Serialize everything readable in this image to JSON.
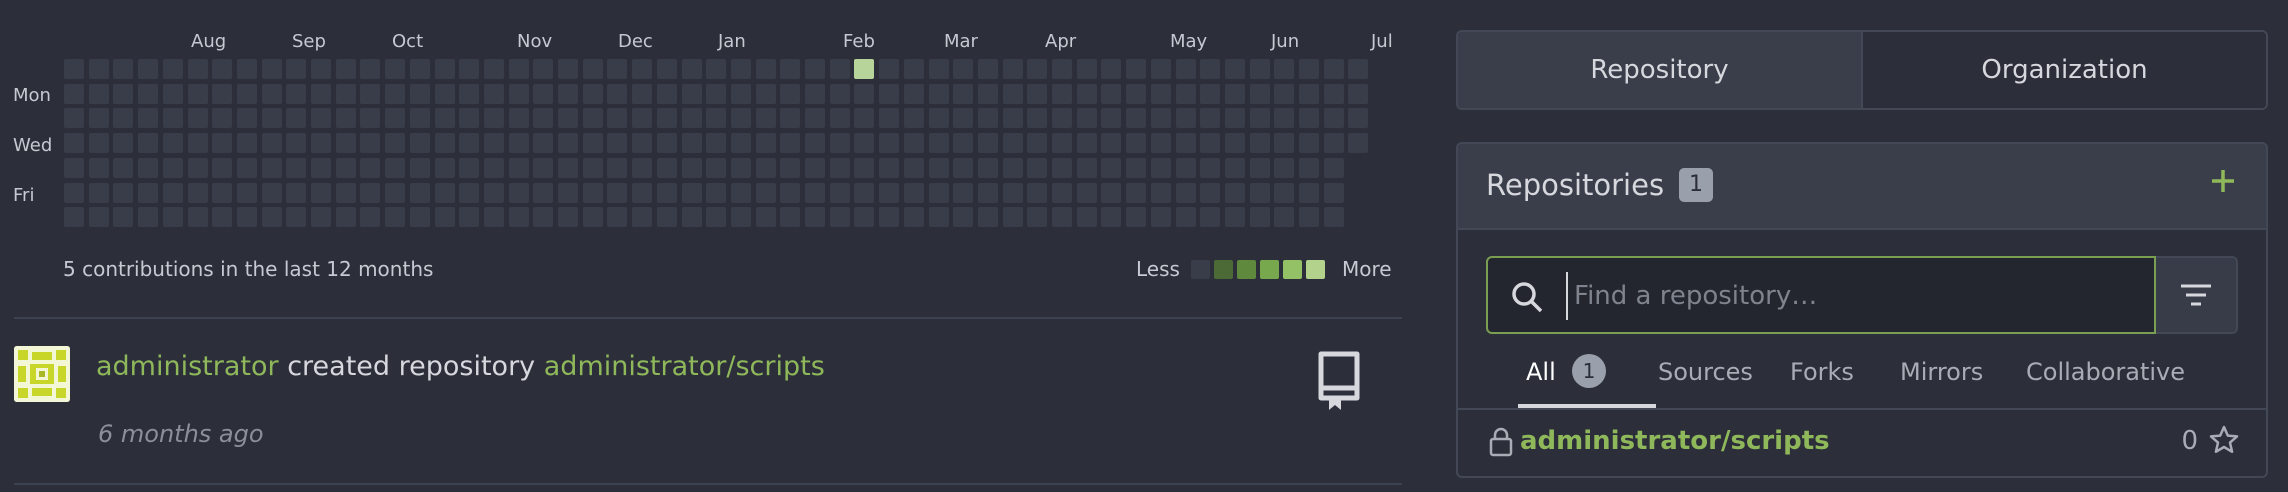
{
  "heatmap": {
    "months": [
      "Aug",
      "Sep",
      "Oct",
      "Nov",
      "Dec",
      "Jan",
      "Feb",
      "Mar",
      "Apr",
      "May",
      "Jun",
      "Jul"
    ],
    "days": [
      "Mon",
      "Wed",
      "Fri"
    ],
    "weeks": 53,
    "last_week_days": 4,
    "active_cells": [
      {
        "week": 32,
        "day": 0,
        "level": 1
      }
    ],
    "summary": "5 contributions in the last 12 months",
    "less_label": "Less",
    "more_label": "More",
    "legend_colors": [
      "#383d49",
      "#4b6a35",
      "#5f8a3e",
      "#78a84d",
      "#94c066",
      "#b3d38d"
    ],
    "active_color": "#b7d49a",
    "empty_color": "#383d49"
  },
  "feed": {
    "actor": "administrator",
    "action": "created repository",
    "target": "administrator/scripts",
    "time": "6 months ago"
  },
  "tabs": {
    "repository": "Repository",
    "organization": "Organization"
  },
  "repos": {
    "title": "Repositories",
    "count": "1",
    "search_placeholder": "Find a repository…",
    "subtabs": {
      "all": "All",
      "all_count": "1",
      "sources": "Sources",
      "forks": "Forks",
      "mirrors": "Mirrors",
      "collaborative": "Collaborative"
    },
    "items": [
      {
        "name": "administrator/scripts",
        "stars": "0",
        "private": true
      }
    ]
  },
  "icons": {
    "add": "plus-icon",
    "search": "search-icon",
    "filter": "filter-icon",
    "lock": "lock-icon",
    "star": "star-icon",
    "repo": "repo-icon"
  },
  "colors": {
    "accent": "#8fb85b",
    "background": "#2c2f3a"
  }
}
